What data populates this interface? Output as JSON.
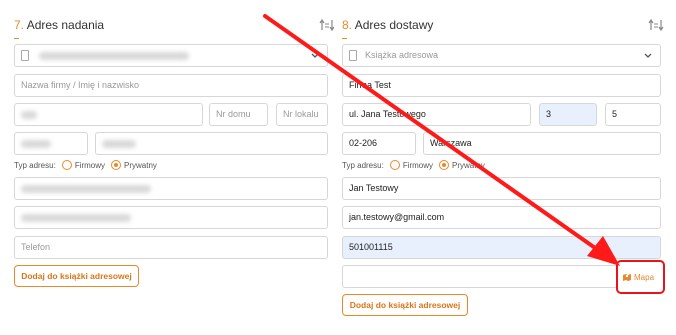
{
  "left": {
    "section_num": "7.",
    "section_title": "Adres nadania",
    "company_placeholder": "Nazwa firmy / Imię i nazwisko",
    "house_placeholder": "Nr domu",
    "flat_placeholder": "Nr lokalu",
    "address_type_label": "Typ adresu:",
    "radio_company": "Firmowy",
    "radio_private": "Prywatny",
    "selected_type": "Prywatny",
    "phone_placeholder": "Telefon",
    "add_button": "Dodaj do książki adresowej"
  },
  "right": {
    "section_num": "8.",
    "section_title": "Adres dostawy",
    "address_book": "Książka adresowa",
    "company": "Firma Test",
    "street": "ul. Jana Testowego",
    "house": "3",
    "flat": "5",
    "postcode": "02-206",
    "city": "Warszawa",
    "address_type_label": "Typ adresu:",
    "radio_company": "Firmowy",
    "radio_private": "Prywatny",
    "selected_type": "Prywatny",
    "contact_name": "Jan Testowy",
    "email": "jan.testowy@gmail.com",
    "phone": "501001115",
    "point": "",
    "map_label": "Mapa",
    "add_button": "Dodaj do książki adresowej"
  },
  "colors": {
    "accent": "#e8892a",
    "highlight": "#e8141c",
    "autofill": "#e8f0fe"
  },
  "icons": [
    "swap-icon",
    "address-book-icon",
    "chevron-down-icon",
    "map-icon"
  ]
}
